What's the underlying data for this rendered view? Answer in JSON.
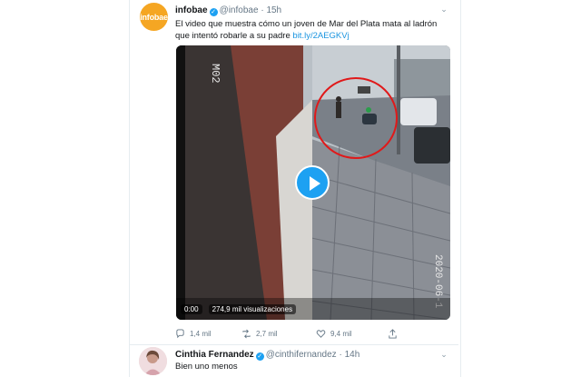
{
  "tweet": {
    "avatar_text": "infobae",
    "name": "infobae",
    "handle": "@infobae",
    "sep": "·",
    "time": "15h",
    "text": "El video que muestra cómo un joven de Mar del Plata mata al ladrón que intentó robarle a su padre ",
    "link": "bit.ly/2AEGKVj",
    "video": {
      "time": "0:00",
      "views": "274,9 mil visualizaciones",
      "overlay_top": "M02",
      "overlay_side": "2020-06-1"
    },
    "actions": {
      "replies": "1,4 mil",
      "retweets": "2,7 mil",
      "likes": "9,4 mil"
    }
  },
  "reply": {
    "name": "Cinthia Fernandez",
    "handle": "@cinthifernandez",
    "sep": "·",
    "time": "14h",
    "text": "Bien uno menos"
  },
  "colors": {
    "accent": "#1da1f2",
    "link": "#1b95e0",
    "muted": "#657786",
    "brand": "#f5a623"
  }
}
